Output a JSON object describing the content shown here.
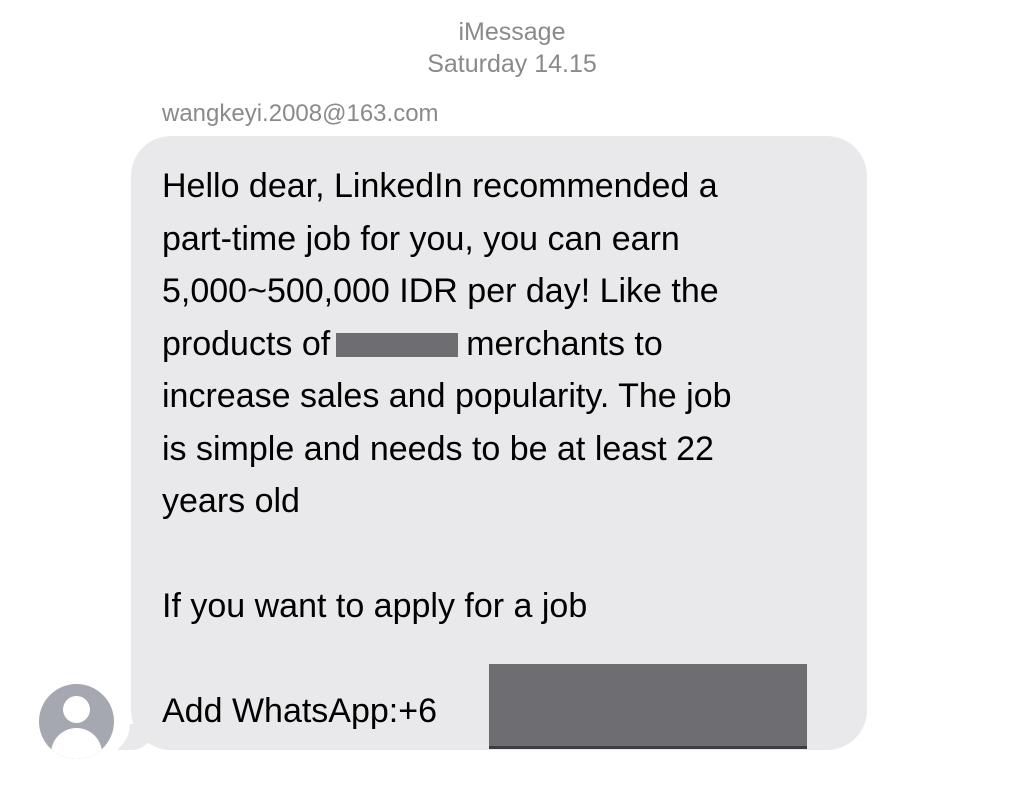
{
  "header": {
    "service": "iMessage",
    "timestamp": "Saturday 14.15"
  },
  "sender": "wangkeyi.2008@163.com",
  "message": {
    "line1": "Hello dear, LinkedIn recommended a",
    "line2": "part-time job for you, you can earn",
    "line3": "5,000~500,000 IDR per day! Like the",
    "line4_before": "products of",
    "line4_after": "merchants to",
    "line5": "increase sales and popularity. The job",
    "line6": "is simple and needs to be at least 22",
    "line7": "years old",
    "line9": "If you want to apply for a job",
    "line11": "Add WhatsApp:+6"
  },
  "icons": {
    "avatar": "person-silhouette-icon"
  },
  "colors": {
    "bubble": "#e9e9eb",
    "meta_text": "#8a8a8e",
    "redaction": "#6e6e72",
    "avatar": "#a5a8b0"
  }
}
